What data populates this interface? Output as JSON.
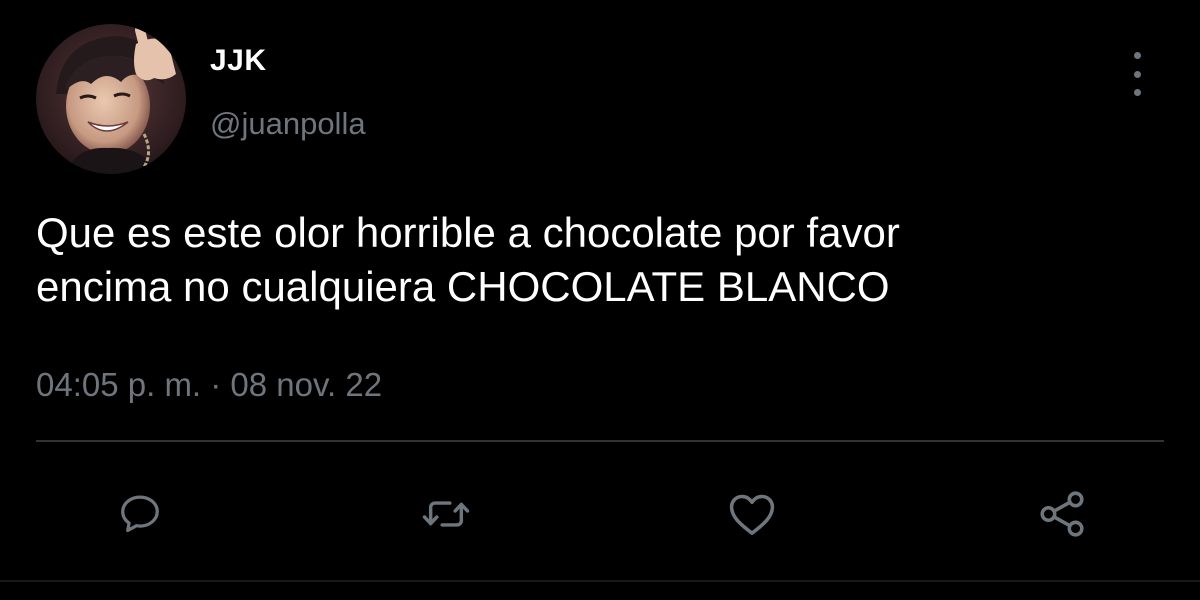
{
  "user": {
    "display_name": "JJK",
    "handle": "@juanpolla"
  },
  "tweet": {
    "text_lines": [
      "Que es este olor horrible a chocolate por favor",
      "encima no cualquiera CHOCOLATE BLANCO"
    ],
    "timestamp": "04:05 p. m. · 08 nov. 22"
  },
  "actions": [
    {
      "icon": "reply-icon"
    },
    {
      "icon": "retweet-icon"
    },
    {
      "icon": "like-icon"
    },
    {
      "icon": "share-icon"
    }
  ],
  "colors": {
    "background": "#000000",
    "primary_text": "#ffffff",
    "secondary_text": "#6e767d",
    "divider": "#2f3336"
  }
}
